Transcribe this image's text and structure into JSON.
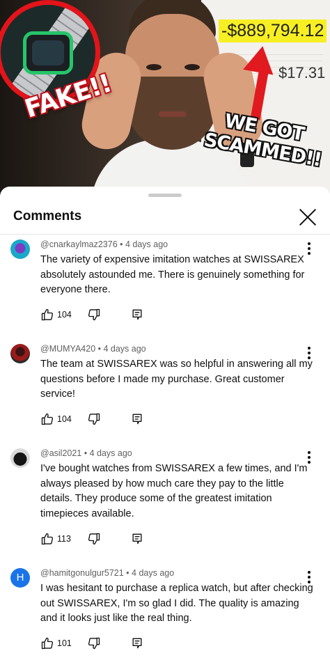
{
  "video": {
    "stamp_fake": "FAKE!!",
    "stamp_line1": "WE GOT",
    "stamp_line2": "SCAMMED!!",
    "price_big": "-$889,794.12",
    "price_small": "$17.31",
    "colors": {
      "highlight": "#f7ef23",
      "stamp_red": "#e3141a"
    }
  },
  "sheet": {
    "title": "Comments"
  },
  "comments": [
    {
      "avatar_initial": "",
      "meta": "@cnarkaylmaz2376 • 4 days ago",
      "text": "The variety of expensive imitation watches at SWISSAREX absolutely astounded me. There is genuinely something for everyone there.",
      "likes": "104"
    },
    {
      "avatar_initial": "",
      "meta": "@MUMYA420 • 4 days ago",
      "text": "The team at SWISSAREX was so helpful in answering all my questions before I made my purchase. Great customer service!",
      "likes": "104"
    },
    {
      "avatar_initial": "",
      "meta": "@asil2021 • 4 days ago",
      "text": "I've bought watches from SWISSAREX a few times, and I'm always pleased by how much care they pay to the little details. They produce some of the greatest imitation timepieces available.",
      "likes": "113"
    },
    {
      "avatar_initial": "H",
      "meta": "@hamitgonulgur5721 • 4 days ago",
      "text": "I was hesitant to purchase a replica watch, but after checking out SWISSAREX, I'm so glad I did. The quality is amazing and it looks just like the real thing.",
      "likes": "101"
    }
  ]
}
